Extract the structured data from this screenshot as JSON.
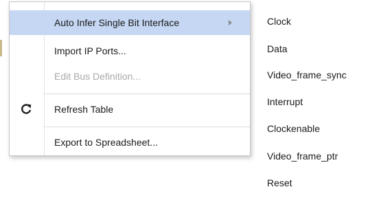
{
  "context_menu": {
    "items": [
      {
        "label": "Auto Infer Single Bit Interface"
      },
      {
        "label": "Import IP Ports..."
      },
      {
        "label": "Edit Bus Definition..."
      },
      {
        "label": "Refresh Table"
      },
      {
        "label": "Export to Spreadsheet..."
      }
    ],
    "highlight_color": "#c5d7f2",
    "disabled_text_color": "#a9a9a9"
  },
  "submenu": {
    "items": [
      {
        "label": "Clock"
      },
      {
        "label": "Data"
      },
      {
        "label": "Video_frame_sync"
      },
      {
        "label": "Interrupt"
      },
      {
        "label": "Clockenable"
      },
      {
        "label": "Video_frame_ptr"
      },
      {
        "label": "Reset"
      }
    ]
  },
  "icons": {
    "refresh": "refresh-icon",
    "submenu_arrow": "chevron-right-icon"
  }
}
